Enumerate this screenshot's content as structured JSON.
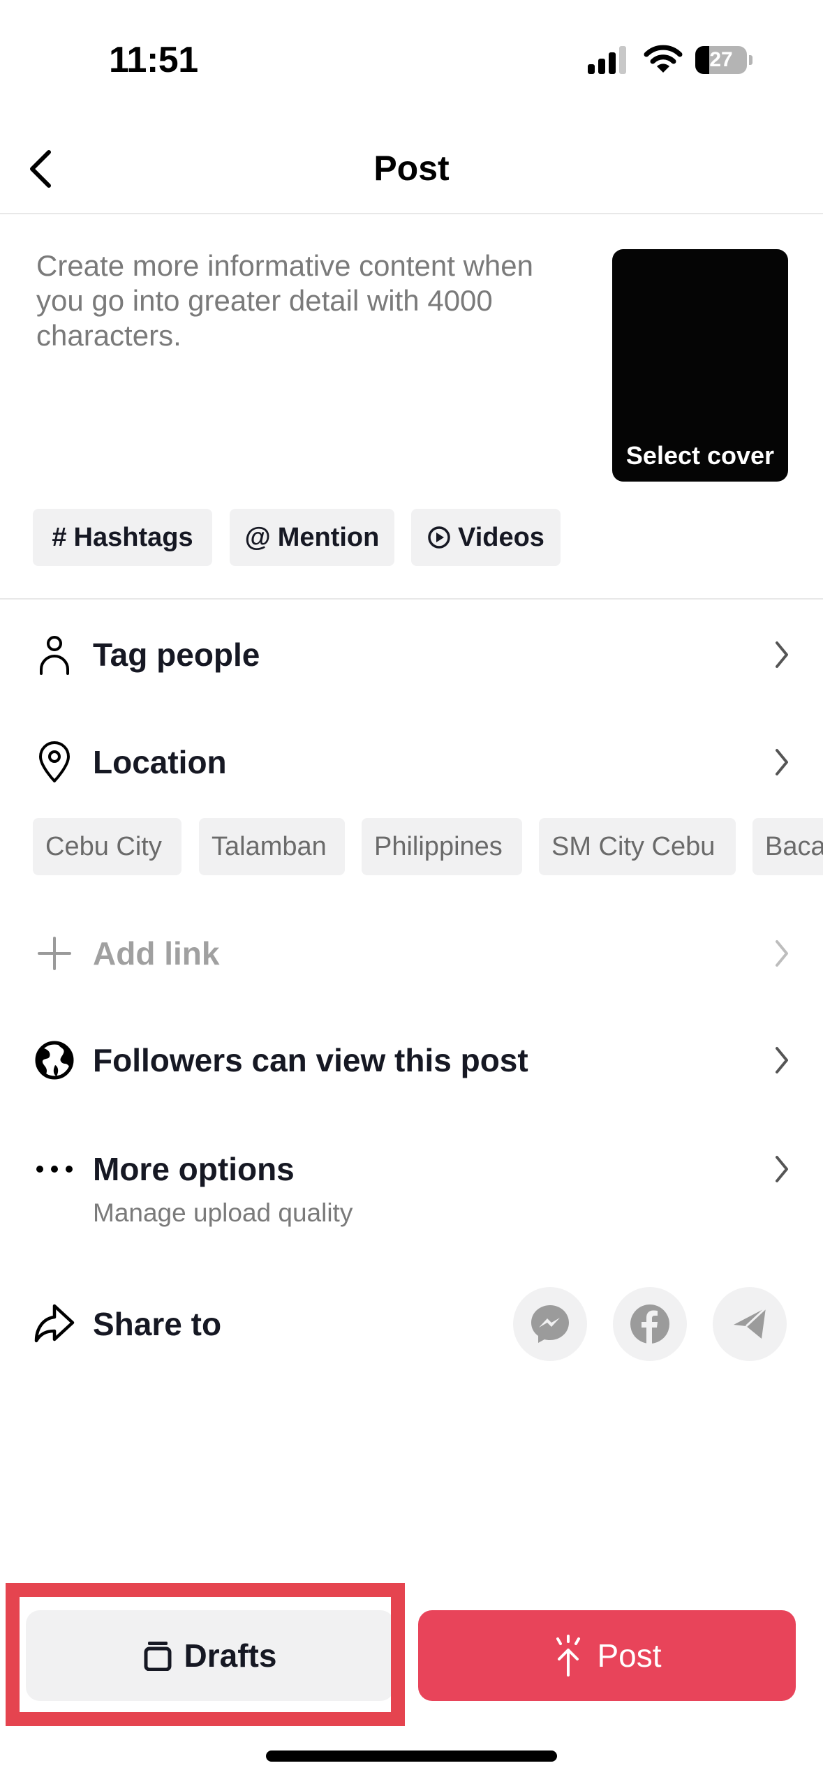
{
  "status_bar": {
    "time": "11:51",
    "battery_percent": 27,
    "battery_label": "27",
    "icons": [
      "signal-icon",
      "wifi-icon",
      "battery-icon"
    ]
  },
  "header": {
    "title": "Post",
    "back_icon": "chevron-left-icon"
  },
  "description": {
    "placeholder": "Create more informative content when you go into greater detail with 4000 characters."
  },
  "cover": {
    "label": "Select cover"
  },
  "chips": [
    {
      "glyph": "#",
      "label": "Hashtags",
      "icon": "hashtag-icon"
    },
    {
      "glyph": "@",
      "label": "Mention",
      "icon": "at-icon"
    },
    {
      "glyph": "",
      "label": "Videos",
      "icon": "play-circle-icon"
    }
  ],
  "rows": {
    "tag_people": {
      "label": "Tag people",
      "icon": "person-icon"
    },
    "location": {
      "label": "Location",
      "icon": "location-pin-icon"
    },
    "add_link": {
      "label": "Add link",
      "icon": "plus-icon",
      "disabled": true
    },
    "visibility": {
      "label": "Followers can view this post",
      "icon": "globe-icon"
    },
    "more_options": {
      "label": "More options",
      "sublabel": "Manage upload quality",
      "icon": "more-dots-icon"
    },
    "share_to": {
      "label": "Share to",
      "icon": "share-arrow-icon"
    }
  },
  "location_suggestions": [
    "Cebu City",
    "Talamban",
    "Philippines",
    "SM City Cebu",
    "Baca"
  ],
  "share_targets": [
    {
      "name": "Messenger",
      "icon": "messenger-icon"
    },
    {
      "name": "Facebook",
      "icon": "facebook-icon"
    },
    {
      "name": "Telegram",
      "icon": "telegram-icon"
    }
  ],
  "actions": {
    "drafts_label": "Drafts",
    "post_label": "Post"
  },
  "colors": {
    "accent": "#e8445a",
    "highlight": "#e5444f",
    "chip_bg": "#f1f1f2",
    "text_primary": "#161823",
    "text_secondary": "#7a7a7a"
  }
}
